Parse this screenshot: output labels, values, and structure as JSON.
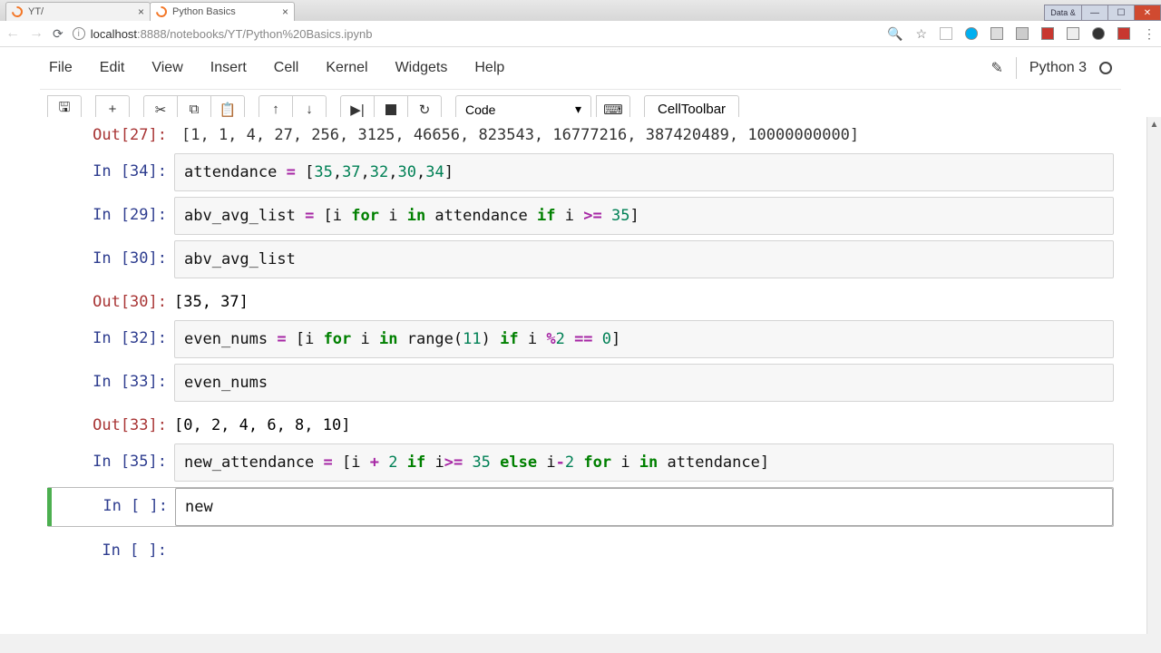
{
  "browser": {
    "tabs": [
      {
        "title": "YT/"
      },
      {
        "title": "Python Basics"
      }
    ],
    "url_host": "localhost",
    "url_path": ":8888/notebooks/YT/Python%20Basics.ipynb",
    "win_data_label": "Data &"
  },
  "menubar": {
    "items": [
      "File",
      "Edit",
      "View",
      "Insert",
      "Cell",
      "Kernel",
      "Widgets",
      "Help"
    ],
    "kernel_name": "Python 3"
  },
  "toolbar": {
    "cell_type": "Code",
    "cell_toolbar_label": "CellToolbar"
  },
  "cells": {
    "truncated_out_prompt": "Out[27]:",
    "truncated_out_text": "[1, 1, 4, 27, 256, 3125, 46656, 823543, 16777216, 387420489, 10000000000]",
    "c34": {
      "prompt": "In [34]:",
      "code": {
        "pre": "attendance ",
        "op1": "=",
        "post": " [",
        "n1": "35",
        "c1": ",",
        "n2": "37",
        "c2": ",",
        "n3": "32",
        "c3": ",",
        "n4": "30",
        "c4": ",",
        "n5": "34",
        "close": "]"
      }
    },
    "c29": {
      "prompt": "In [29]:",
      "pre": "abv_avg_list ",
      "op_eq": "=",
      "post1": " [i ",
      "kw_for": "for",
      "post2": " i ",
      "kw_in": "in",
      "post3": " attendance ",
      "kw_if": "if",
      "post4": " i ",
      "op_ge": ">=",
      "post5": " ",
      "n35": "35",
      "close": "]"
    },
    "c30": {
      "prompt": "In [30]:",
      "code_text": "abv_avg_list"
    },
    "o30": {
      "prompt": "Out[30]:",
      "text": "[35, 37]"
    },
    "c32": {
      "prompt": "In [32]:",
      "pre": "even_nums ",
      "op_eq": "=",
      "post1": " [i ",
      "kw_for": "for",
      "post2": " i ",
      "kw_in": "in",
      "post3": " range(",
      "n11": "11",
      "post4": ") ",
      "kw_if": "if",
      "post5": " i ",
      "op_mod": "%",
      "n2": "2",
      "sp": " ",
      "op_eqeq": "==",
      "sp2": " ",
      "n0": "0",
      "close": "]"
    },
    "c33": {
      "prompt": "In [33]:",
      "code_text": "even_nums"
    },
    "o33": {
      "prompt": "Out[33]:",
      "text": "[0, 2, 4, 6, 8, 10]"
    },
    "c35": {
      "prompt": "In [35]:",
      "pre": "new_attendance ",
      "op_eq": "=",
      "post1": " [i ",
      "op_plus": "+",
      "sp1": " ",
      "n2a": "2",
      "sp2": " ",
      "kw_if": "if",
      "post2": " i",
      "op_ge": ">=",
      "sp3": " ",
      "n35": "35",
      "sp4": " ",
      "kw_else": "else",
      "post3": " i",
      "op_minus": "-",
      "n2b": "2",
      "sp5": " ",
      "kw_for": "for",
      "post4": " i ",
      "kw_in": "in",
      "post5": " attendance]"
    },
    "active": {
      "prompt": "In [ ]:",
      "code_text": "new"
    },
    "below": {
      "prompt": "In [ ]:"
    }
  }
}
